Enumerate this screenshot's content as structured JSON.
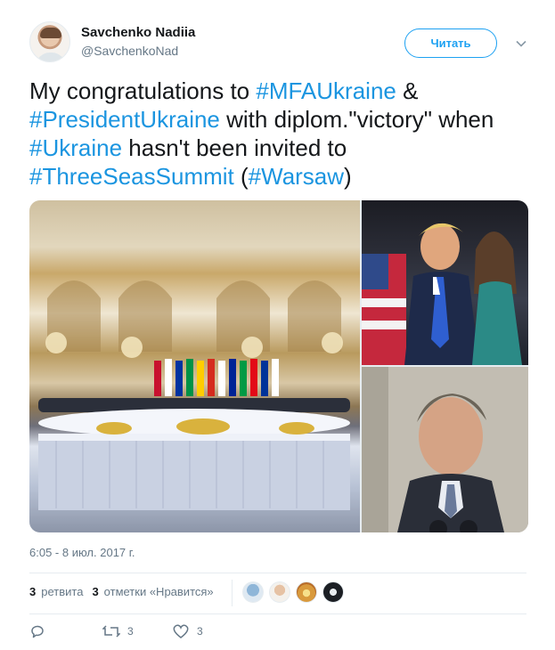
{
  "author": {
    "name": "Savchenko Nadiia",
    "handle": "@SavchenkoNad"
  },
  "follow_label": "Читать",
  "tweet_text": {
    "p1": "My congratulations to ",
    "h1": "#MFAUkraine",
    "p2": " & ",
    "h2": "#PresidentUkraine",
    "p3": " with diplom.\"victory\" when ",
    "h3": "#Ukraine",
    "p4": " hasn't been invited to ",
    "h4": "#ThreeSeasSummit",
    "p5": "  (",
    "h5": "#Warsaw",
    "p6": ")"
  },
  "timestamp": "6:05 - 8 июл. 2017 г.",
  "stats": {
    "retweets_count": "3",
    "retweets_label": "ретвита",
    "likes_count": "3",
    "likes_label": "отметки «Нравится»"
  },
  "actions": {
    "retweet_count": "3",
    "like_count": "3"
  },
  "colors": {
    "hashtag": "#1b95e0",
    "follow_accent": "#1da1f2",
    "meta_text": "#657786"
  },
  "icons": [
    "chevron-down-icon",
    "reply-icon",
    "retweet-icon",
    "heart-icon"
  ]
}
